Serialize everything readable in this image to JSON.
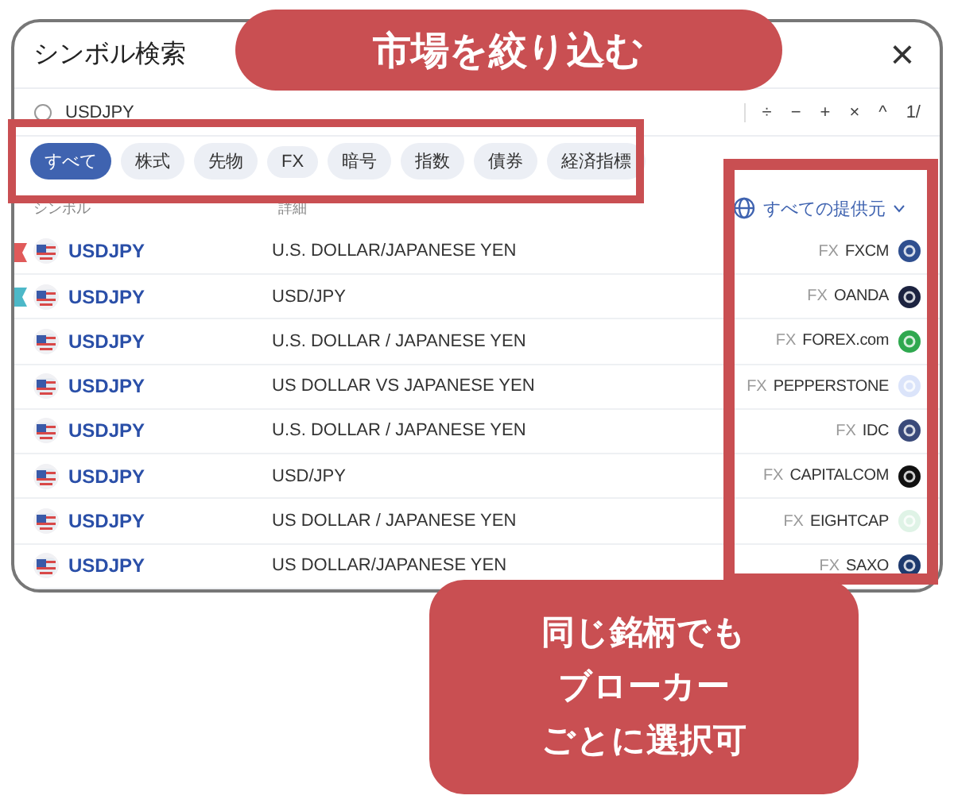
{
  "dialog": {
    "title": "シンボル検索",
    "close": "×"
  },
  "search": {
    "value": "USDJPY",
    "tools": [
      "÷",
      "−",
      "+",
      "×",
      "^",
      "1/"
    ]
  },
  "filters": [
    {
      "label": "すべて",
      "selected": true
    },
    {
      "label": "株式",
      "selected": false
    },
    {
      "label": "先物",
      "selected": false
    },
    {
      "label": "FX",
      "selected": false
    },
    {
      "label": "暗号",
      "selected": false
    },
    {
      "label": "指数",
      "selected": false
    },
    {
      "label": "債券",
      "selected": false
    },
    {
      "label": "経済指標",
      "selected": false
    }
  ],
  "columns": {
    "symbol": "シンボル",
    "detail": "詳細",
    "source": "すべての提供元"
  },
  "rows": [
    {
      "symbol": "USDJPY",
      "detail": "U.S. DOLLAR/JAPANESE YEN",
      "type": "FX",
      "provider": "FXCM",
      "logo": {
        "color": "#2f4f8f"
      },
      "flag": {
        "color": "#e05a5a"
      }
    },
    {
      "symbol": "USDJPY",
      "detail": "USD/JPY",
      "type": "FX",
      "provider": "OANDA",
      "logo": {
        "color": "#1c2340"
      },
      "flag": {
        "color": "#4db8c8"
      }
    },
    {
      "symbol": "USDJPY",
      "detail": "U.S. DOLLAR / JAPANESE YEN",
      "type": "FX",
      "provider": "FOREX.com",
      "logo": {
        "color": "#2fa84f"
      }
    },
    {
      "symbol": "USDJPY",
      "detail": "US DOLLAR VS JAPANESE YEN",
      "type": "FX",
      "provider": "PEPPERSTONE",
      "logo": {
        "color": "#dbe4fa"
      }
    },
    {
      "symbol": "USDJPY",
      "detail": "U.S. DOLLAR / JAPANESE YEN",
      "type": "FX",
      "provider": "IDC",
      "logo": {
        "color": "#3a4a7a"
      }
    },
    {
      "symbol": "USDJPY",
      "detail": "USD/JPY",
      "type": "FX",
      "provider": "CAPITALCOM",
      "logo": {
        "color": "#111111"
      }
    },
    {
      "symbol": "USDJPY",
      "detail": "US DOLLAR / JAPANESE YEN",
      "type": "FX",
      "provider": "EIGHTCAP",
      "logo": {
        "color": "#dff3e6"
      }
    },
    {
      "symbol": "USDJPY",
      "detail": "US DOLLAR/JAPANESE YEN",
      "type": "FX",
      "provider": "SAXO",
      "logo": {
        "color": "#1e3a6e"
      }
    }
  ],
  "callouts": [
    {
      "kind": "banner",
      "lines": [
        "市場を絞り込む"
      ]
    },
    {
      "kind": "note",
      "lines": [
        "同じ銘柄でも",
        "ブローカー",
        "ごとに選択可"
      ]
    }
  ]
}
